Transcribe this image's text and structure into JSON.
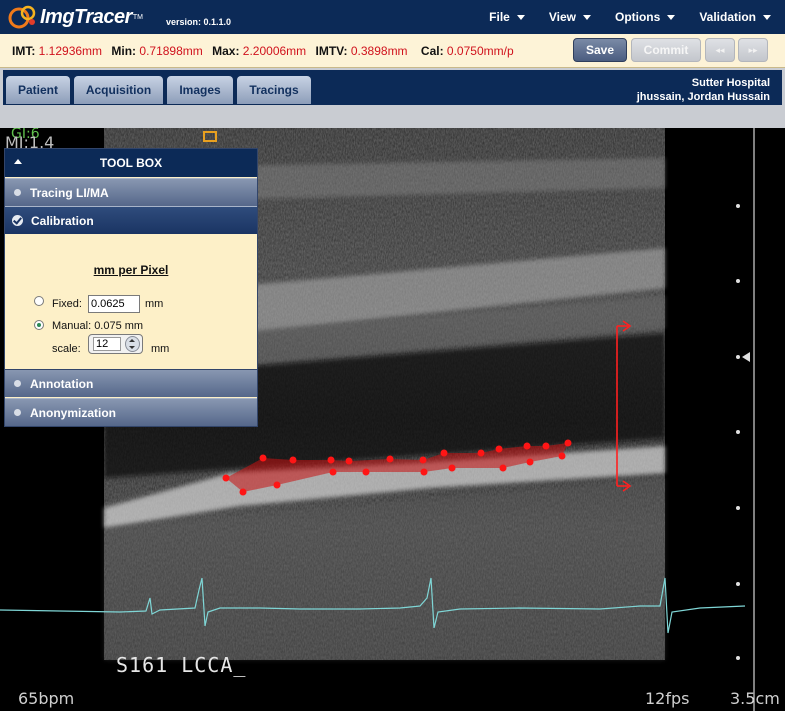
{
  "header": {
    "app_name": "ImgTracer",
    "trademark": "TM",
    "version": "version: 0.1.1.0",
    "menu": [
      "File",
      "View",
      "Options",
      "Validation"
    ]
  },
  "measurements": {
    "imt_label": "IMT:",
    "imt": "1.12936mm",
    "min_label": "Min:",
    "min": "0.71898mm",
    "max_label": "Max:",
    "max": "2.20006mm",
    "imtv_label": "IMTV:",
    "imtv": "0.3898mm",
    "cal_label": "Cal:",
    "cal": "0.0750mm/p"
  },
  "actions": {
    "save": "Save",
    "commit": "Commit",
    "prev": "◂◂",
    "next": "▸▸"
  },
  "tabs": [
    "Patient",
    "Acquisition",
    "Images",
    "Tracings"
  ],
  "user": {
    "hospital": "Sutter Hospital",
    "name": "jhussain, Jordan Hussain"
  },
  "toolbox": {
    "title": "TOOL BOX",
    "sections": {
      "tracing": "Tracing LI/MA",
      "calibration": "Calibration",
      "annotation": "Annotation",
      "anonymization": "Anonymization"
    },
    "calibration": {
      "title": "mm per Pixel",
      "fixed_label": "Fixed:",
      "fixed_value": "0.0625",
      "unit": "mm",
      "manual_label": "Manual: 0.075 mm",
      "scale_label": "scale:",
      "scale_value": "12",
      "selected": "manual"
    }
  },
  "overlay": {
    "gain": "GI:6",
    "mi": "MI:1.4",
    "image_label": "S161 LCCA_",
    "heart_rate": "65bpm",
    "frame_rate": "12fps",
    "depth": "3.5cm"
  },
  "colors": {
    "header_bg": "#0c2a57",
    "measure_bg": "#fdf3d7",
    "value_red": "#d0121d",
    "trace_red": "#ff1010",
    "ecg": "#7fd6d6"
  }
}
